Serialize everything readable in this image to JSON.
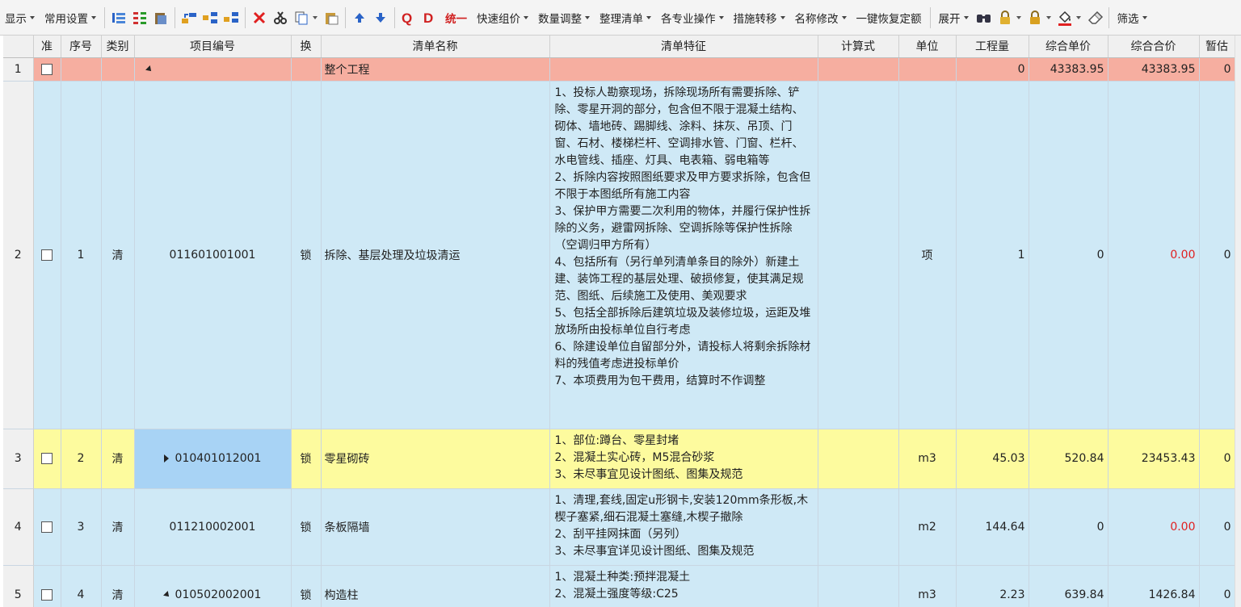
{
  "toolbar": {
    "display": "显示",
    "common_settings": "常用设置",
    "unify": "统一",
    "quick_pricing": "快速组价",
    "quantity_adjust": "数量调整",
    "organize_list": "整理清单",
    "specialty_ops": "各专业操作",
    "measure_transfer": "措施转移",
    "rename": "名称修改",
    "restore_quota": "一键恢复定额",
    "expand": "展开",
    "filter": "筛选"
  },
  "columns": {
    "rownum": "",
    "check": "准",
    "seq": "序号",
    "category": "类别",
    "code": "项目编号",
    "swap": "换",
    "name": "清单名称",
    "feature": "清单特征",
    "formula": "计算式",
    "unit": "单位",
    "quantity": "工程量",
    "unit_price": "综合单价",
    "total_price": "综合合价",
    "provisional": "暂估"
  },
  "rows": [
    {
      "rownum": "1",
      "seq": "",
      "category": "",
      "code": "",
      "swap": "",
      "name": "整个工程",
      "feature": "",
      "formula": "",
      "unit": "",
      "quantity": "0",
      "unit_price": "43383.95",
      "total_price": "43383.95",
      "provisional": "0"
    },
    {
      "rownum": "2",
      "seq": "1",
      "category": "清",
      "code": "011601001001",
      "swap": "锁",
      "name": "拆除、基层处理及垃圾清运",
      "feature": "1、投标人勘察现场，拆除现场所有需要拆除、铲除、零星开洞的部分，包含但不限于混凝土结构、砌体、墙地砖、踢脚线、涂料、抹灰、吊顶、门窗、石材、楼梯栏杆、空调排水管、门窗、栏杆、水电管线、插座、灯具、电表箱、弱电箱等\n2、拆除内容按照图纸要求及甲方要求拆除，包含但不限于本图纸所有施工内容\n3、保护甲方需要二次利用的物体，并履行保护性拆除的义务，避雷网拆除、空调拆除等保护性拆除（空调归甲方所有）\n4、包括所有（另行单列清单条目的除外）新建土建、装饰工程的基层处理、破损修复，使其满足规范、图纸、后续施工及使用、美观要求\n5、包括全部拆除后建筑垃圾及装修垃圾，运距及堆放场所由投标单位自行考虑\n6、除建设单位自留部分外，请投标人将剩余拆除材料的残值考虑进投标单价\n7、本项费用为包干费用，结算时不作调整",
      "formula": "",
      "unit": "项",
      "quantity": "1",
      "unit_price": "0",
      "total_price": "0.00",
      "provisional": "0"
    },
    {
      "rownum": "3",
      "seq": "2",
      "category": "清",
      "code": "010401012001",
      "swap": "锁",
      "name": "零星砌砖",
      "feature": "1、部位:蹲台、零星封堵\n2、混凝土实心砖，M5混合砂浆\n3、未尽事宜见设计图纸、图集及规范",
      "formula": "",
      "unit": "m3",
      "quantity": "45.03",
      "unit_price": "520.84",
      "total_price": "23453.43",
      "provisional": "0"
    },
    {
      "rownum": "4",
      "seq": "3",
      "category": "清",
      "code": "011210002001",
      "swap": "锁",
      "name": "条板隔墙",
      "feature": "1、清理,套线,固定u形钢卡,安装120mm条形板,木楔子塞紧,细石混凝土塞缝,木楔子撤除\n2、刮平挂网抹面（另列）\n3、未尽事宜详见设计图纸、图集及规范",
      "formula": "",
      "unit": "m2",
      "quantity": "144.64",
      "unit_price": "0",
      "total_price": "0.00",
      "provisional": "0"
    },
    {
      "rownum": "5",
      "seq": "4",
      "category": "清",
      "code": "010502002001",
      "swap": "锁",
      "name": "构造柱",
      "feature": "1、混凝土种类:预拌混凝土\n2、混凝土强度等级:C25",
      "formula": "",
      "unit": "m3",
      "quantity": "2.23",
      "unit_price": "639.84",
      "total_price": "1426.84",
      "provisional": "0"
    }
  ]
}
